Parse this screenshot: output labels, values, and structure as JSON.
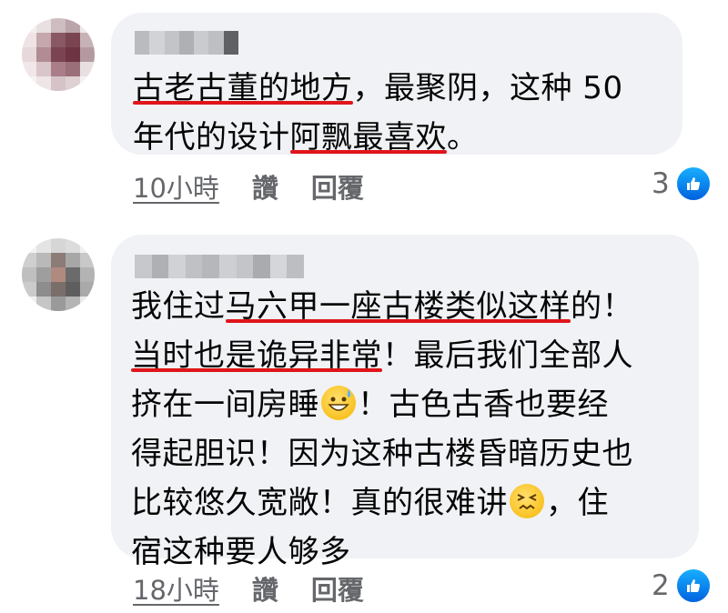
{
  "comments": [
    {
      "avatar_colors": [
        "#f4eeee",
        "#e9e0e1",
        "#cdbcc0",
        "#bba5ab",
        "#efe8e9",
        "#eee3e5",
        "#c4a8ae",
        "#8a5864",
        "#7b4451",
        "#c7b3b7",
        "#e6d8db",
        "#b18c94",
        "#7a4452",
        "#6e3443",
        "#b49aa0",
        "#f1e7e9",
        "#d9c6ca",
        "#a97e89",
        "#9b6f7a",
        "#e8dfe1",
        "#f7f2f3",
        "#eee5e7",
        "#d5c3c7",
        "#dfd0d3",
        "#f5f0f1"
      ],
      "name_colors": [
        "#b9bbbe",
        "#d1d3d6",
        "#c2c4c7",
        "#aeb0b3",
        "#c9cbce",
        "#bdbfc2",
        "#5f6164"
      ],
      "text_line1": [
        "古老古董的地方",
        "，最聚阴，这种 50"
      ],
      "text_line2": [
        "年代的设计",
        "阿飘最喜欢",
        "。"
      ],
      "time": "10小時",
      "like_label": "讚",
      "reply_label": "回覆",
      "reaction_count": "3"
    },
    {
      "avatar_colors": [
        "#f3f3f3",
        "#e4e4e4",
        "#d6d6d6",
        "#dcdcdc",
        "#f0f0f0",
        "#cfcfcf",
        "#b9b9b9",
        "#8c7b77",
        "#a7a7a7",
        "#c8c8c8",
        "#bfbfbf",
        "#9e9e9e",
        "#b08a7f",
        "#6b6b6b",
        "#b3b3b3",
        "#cbcbcb",
        "#8d8d8d",
        "#7a6e6b",
        "#5e5e5e",
        "#a9a9a9",
        "#f0f0f0",
        "#c6c6c6",
        "#9a9a9a",
        "#b4b4b4",
        "#ebebeb"
      ],
      "name_colors": [
        "#c6c8cb",
        "#aeb0b3",
        "#d0d2d5",
        "#bfc1c4",
        "#b5b7ba",
        "#cdcfd2",
        "#c3c5c8",
        "#a9abae",
        "#d4d6d9",
        "#bcbec1"
      ],
      "line1": [
        "我住过",
        "马六甲一座古楼类似这样",
        "的！"
      ],
      "line2": [
        "当时也是诡异非常",
        "！最后我们全部人"
      ],
      "line3a": "挤在一间房睡",
      "line3b": "！古色古香也要经",
      "line4": "得起胆识！因为这种古楼昏暗历史也",
      "line5a": "比较悠久宽敞！真的很难讲",
      "line5b": "，住",
      "line6": "宿这种要人够多",
      "time": "18小時",
      "like_label": "讚",
      "reply_label": "回覆",
      "reaction_count": "2"
    }
  ],
  "icons": {
    "like": "thumbs-up-icon",
    "emoji_sweat": "grinning-sweat-emoji",
    "emoji_confounded": "confounded-face-emoji"
  },
  "colors": {
    "bubble": "#f0f2f5",
    "underline": "#e0151a",
    "meta_text": "#65676b",
    "like_blue": "#1877f2"
  }
}
